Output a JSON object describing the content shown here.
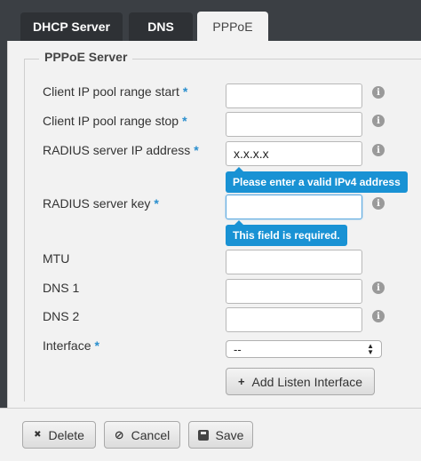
{
  "tabs": [
    {
      "label": "DHCP Server"
    },
    {
      "label": "DNS"
    },
    {
      "label": "PPPoE"
    }
  ],
  "section": {
    "legend": "PPPoE Server"
  },
  "fields": {
    "pool_start": {
      "label": "Client IP pool range start",
      "required": "*",
      "value": ""
    },
    "pool_stop": {
      "label": "Client IP pool range stop",
      "required": "*",
      "value": ""
    },
    "radius_ip": {
      "label": "RADIUS server IP address",
      "required": "*",
      "value": "x.x.x.x",
      "error": "Please enter a valid IPv4 address"
    },
    "radius_key": {
      "label": "RADIUS server key",
      "required": "*",
      "value": "",
      "error": "This field is required."
    },
    "mtu": {
      "label": "MTU",
      "value": ""
    },
    "dns1": {
      "label": "DNS 1",
      "value": ""
    },
    "dns2": {
      "label": "DNS 2",
      "value": ""
    },
    "interface": {
      "label": "Interface",
      "required": "*",
      "value": "--"
    }
  },
  "buttons": {
    "add_listen": {
      "label": "Add Listen Interface",
      "icon": "+"
    },
    "delete": {
      "label": "Delete",
      "icon": "✖"
    },
    "cancel": {
      "label": "Cancel",
      "icon": "⊘"
    },
    "save": {
      "label": "Save"
    }
  },
  "colors": {
    "accent": "#1992d4",
    "background": "#3b3f44",
    "panel": "#f2f2f2"
  }
}
